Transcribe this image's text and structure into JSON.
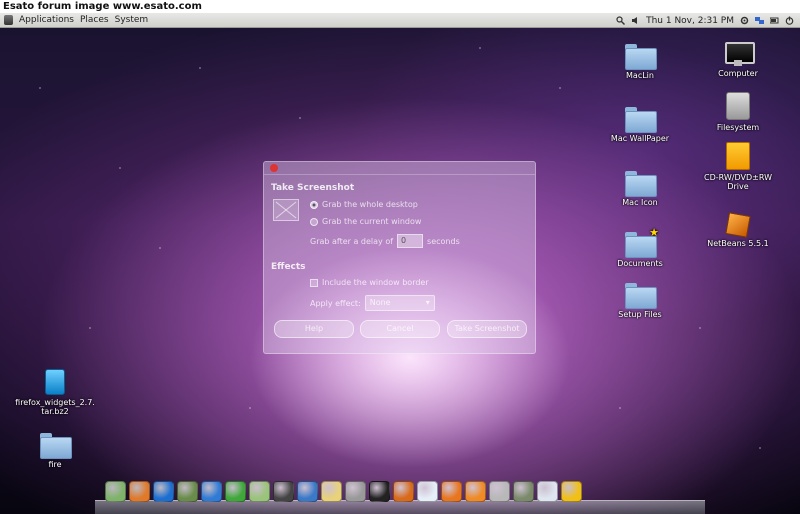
{
  "watermark": "Esato forum image www.esato.com",
  "panel": {
    "menus": [
      "Applications",
      "Places",
      "System"
    ],
    "clock": "Thu  1 Nov,  2:31 PM",
    "tray_icons": [
      "search-icon",
      "volume-icon",
      "settings-icon",
      "network-icon",
      "battery-icon",
      "power-icon"
    ]
  },
  "desktop_icons": {
    "maclin": "MacLin",
    "computer": "Computer",
    "filesystem": "Filesystem",
    "mac_wallpaper": "Mac WallPaper",
    "cd_rw": "CD-RW/DVD±RW Drive",
    "mac_icon": "Mac Icon",
    "netbeans": "NetBeans 5.5.1",
    "documents": "Documents",
    "setup_files": "Setup Files",
    "firefox_widgets": "firefox_widgets_2.7.tar.bz2",
    "fire": "fire"
  },
  "dialog": {
    "heading": "Take Screenshot",
    "option_whole": "Grab the whole desktop",
    "option_window": "Grab the current window",
    "delay_label": "Grab after a delay of",
    "delay_value": "0",
    "delay_unit": "seconds",
    "effects_heading": "Effects",
    "include_border": "Include the window border",
    "apply_effect_label": "Apply effect:",
    "apply_effect_value": "None",
    "help": "Help",
    "cancel": "Cancel",
    "take": "Take Screenshot"
  },
  "dock": {
    "items": [
      {
        "name": "image-viewer-icon",
        "color": "#7fb36a"
      },
      {
        "name": "gimp-icon",
        "color": "#e07a2a"
      },
      {
        "name": "writer-icon",
        "color": "#1c6fd1"
      },
      {
        "name": "calculator-icon",
        "color": "#6a8c4a"
      },
      {
        "name": "inkscape-icon",
        "color": "#2f7bd6"
      },
      {
        "name": "network-tool-icon",
        "color": "#3ea83a"
      },
      {
        "name": "disc-burner-icon",
        "color": "#9ac47a"
      },
      {
        "name": "display-icon",
        "color": "#444444"
      },
      {
        "name": "remote-desktop-icon",
        "color": "#3a78c8"
      },
      {
        "name": "photo-icon",
        "color": "#e8d27a"
      },
      {
        "name": "camera-lens-icon",
        "color": "#999999"
      },
      {
        "name": "terminal-icon",
        "color": "#222222"
      },
      {
        "name": "package-icon",
        "color": "#d86a1a"
      },
      {
        "name": "text-document-icon",
        "color": "#e6eef8"
      },
      {
        "name": "firefox-icon",
        "color": "#e9761e"
      },
      {
        "name": "firefox-browser-icon",
        "color": "#f08a24"
      },
      {
        "name": "trash-icon",
        "color": "#b8b8b8"
      },
      {
        "name": "media-player-icon",
        "color": "#7a8a6a"
      },
      {
        "name": "weather-icon",
        "color": "#dfe6ef"
      },
      {
        "name": "battery-charge-icon",
        "color": "#f2c014"
      }
    ]
  }
}
